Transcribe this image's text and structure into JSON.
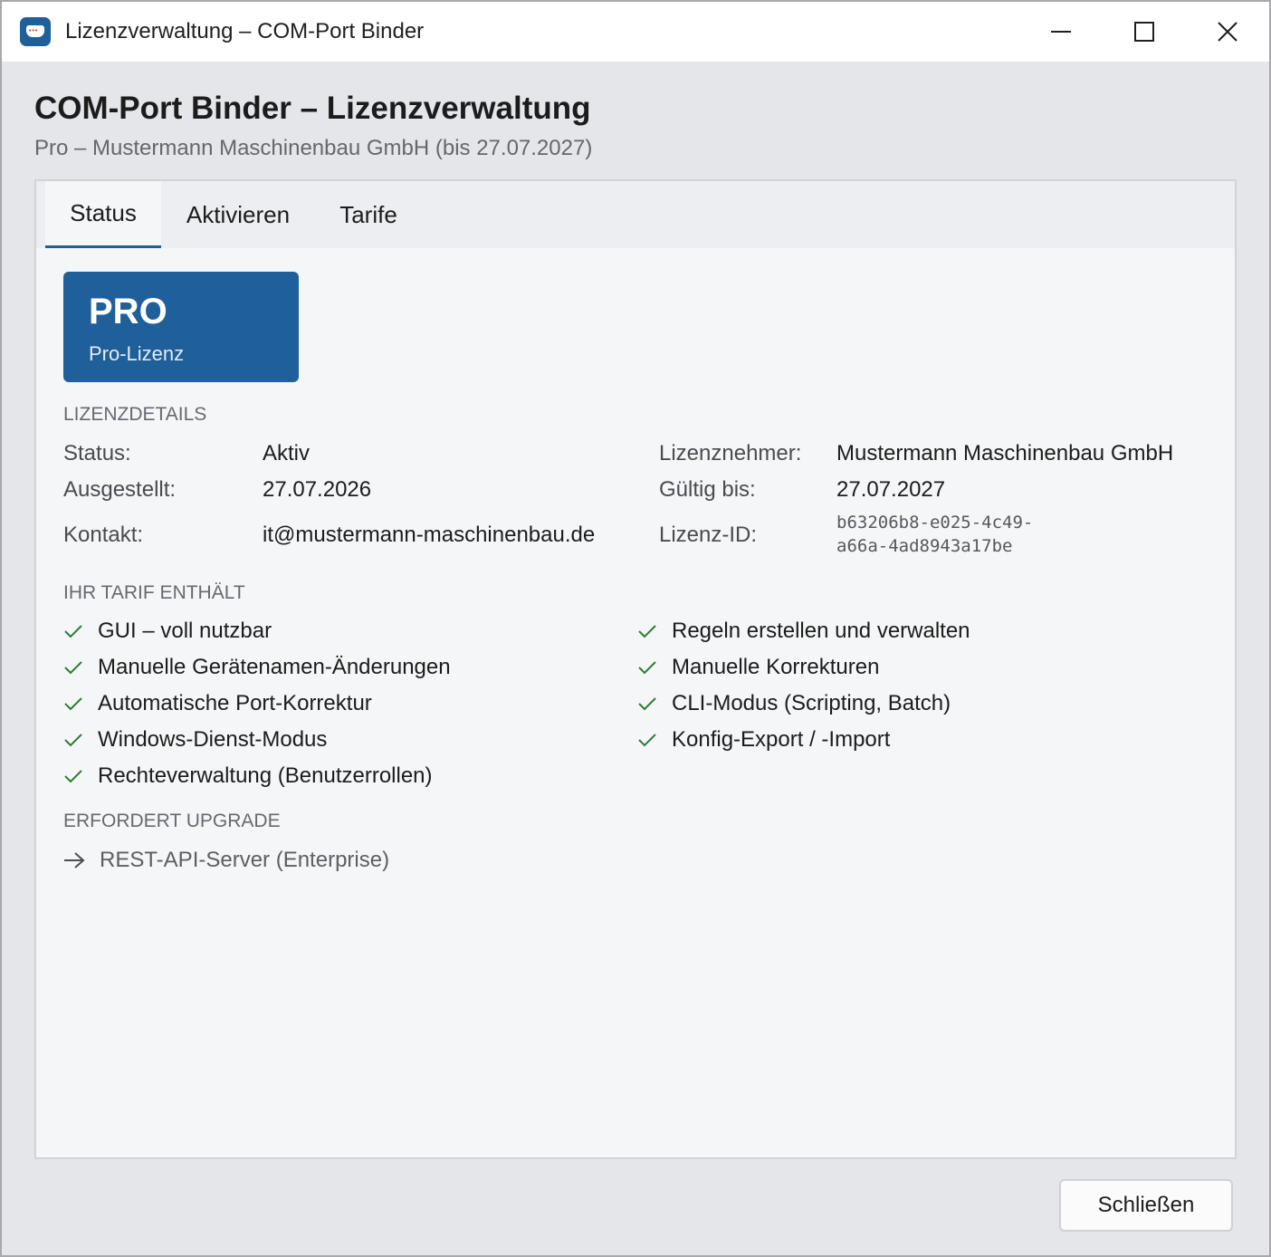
{
  "window": {
    "title": "Lizenzverwaltung – COM-Port Binder",
    "app_icon": "com-port-binder-app-icon",
    "controls": [
      "minimize-icon",
      "maximize-icon",
      "close-icon"
    ]
  },
  "header": {
    "title": "COM-Port Binder – Lizenzverwaltung",
    "subtitle": "Pro – Mustermann Maschinenbau GmbH (bis 27.07.2027)"
  },
  "tabs": [
    {
      "label": "Status",
      "active": true
    },
    {
      "label": "Aktivieren",
      "active": false
    },
    {
      "label": "Tarife",
      "active": false
    }
  ],
  "badge": {
    "tier": "PRO",
    "name": "Pro-Lizenz",
    "color": "#1f5f9a"
  },
  "details": {
    "section_label": "LIZENZDETAILS",
    "status_label": "Status:",
    "status_value": "Aktiv",
    "issued_label": "Ausgestellt:",
    "issued_value": "27.07.2026",
    "contact_label": "Kontakt:",
    "contact_value": "it@mustermann-maschinenbau.de",
    "licensee_label": "Lizenznehmer:",
    "licensee_value": "Mustermann Maschinenbau GmbH",
    "valid_label": "Gültig bis:",
    "valid_value": "27.07.2027",
    "id_label": "Lizenz-ID:",
    "id_value_line1": "b63206b8-e025-4c49-",
    "id_value_line2": "a66a-4ad8943a17be"
  },
  "features": {
    "section_label": "IHR TARIF ENTHÄLT",
    "check_color": "#2e7d32",
    "left": [
      "GUI – voll nutzbar",
      "Manuelle Gerätenamen-Änderungen",
      "Automatische Port-Korrektur",
      "Windows-Dienst-Modus",
      "Rechteverwaltung (Benutzerrollen)"
    ],
    "right": [
      "Regeln erstellen und verwalten",
      "Manuelle Korrekturen",
      "CLI-Modus (Scripting, Batch)",
      "Konfig-Export / -Import"
    ]
  },
  "upgrade": {
    "section_label": "ERFORDERT UPGRADE",
    "items": [
      "REST-API-Server (Enterprise)"
    ]
  },
  "footer": {
    "close_label": "Schließen"
  }
}
